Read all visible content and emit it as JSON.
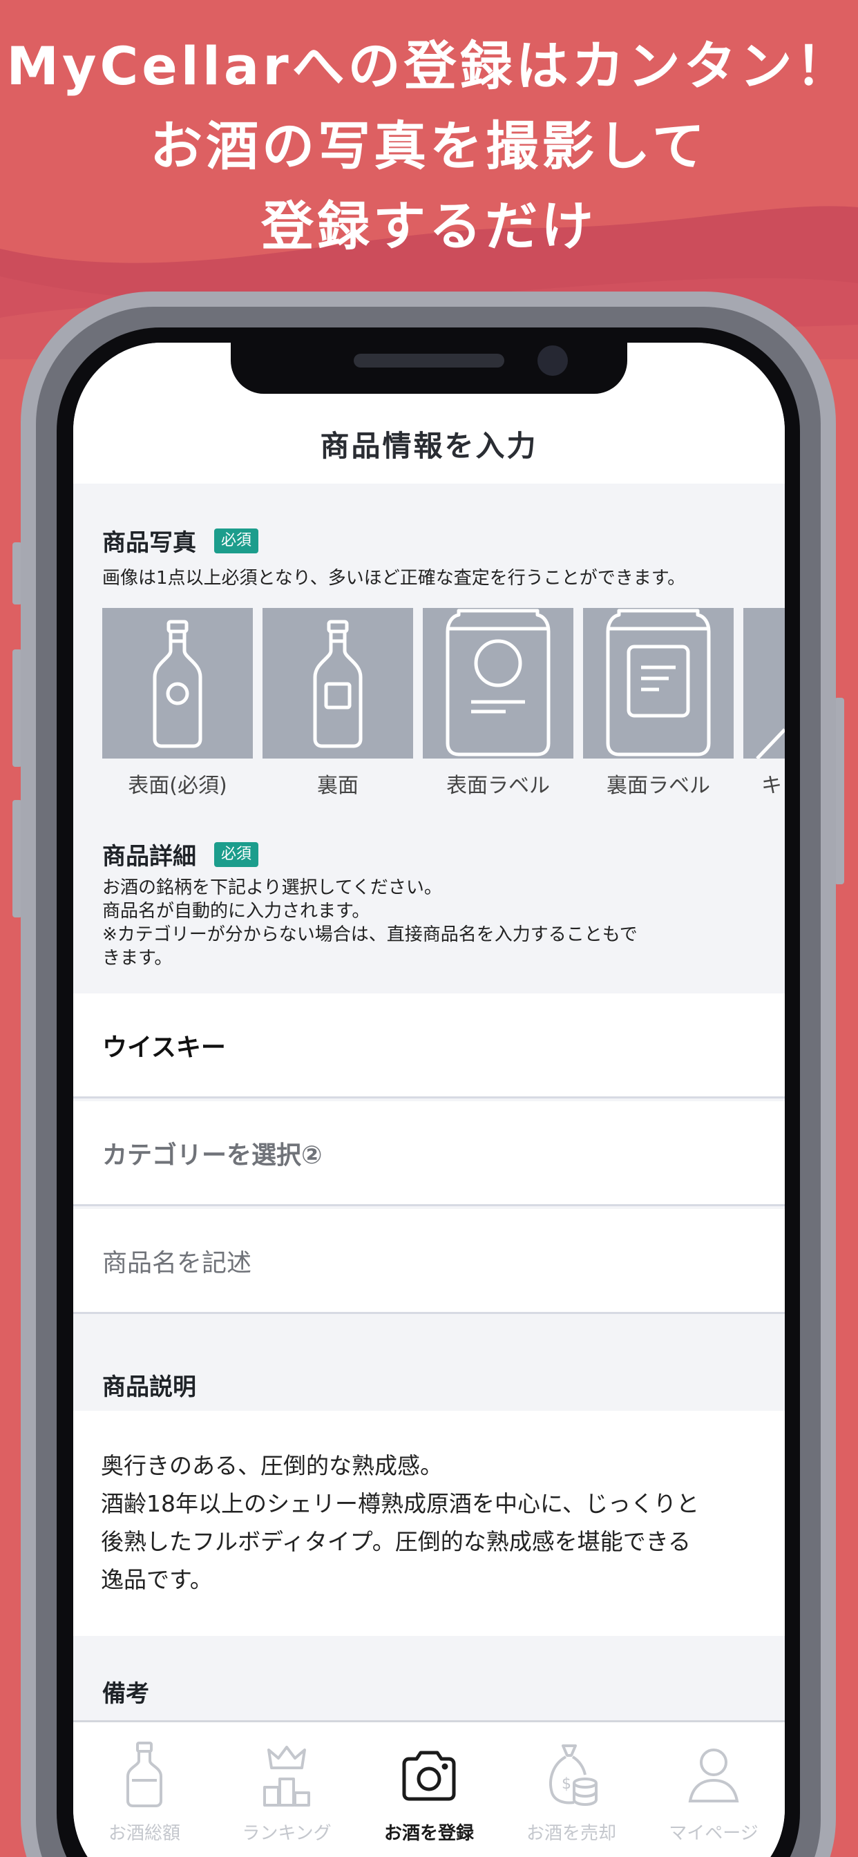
{
  "headline": {
    "line1": "MyCellarへの登録はカンタン！",
    "line2": "お酒の写真を撮影して",
    "line3": "登録するだけ"
  },
  "screen_title": "商品情報を入力",
  "photos": {
    "title": "商品写真",
    "badge": "必須",
    "note": "画像は1点以上必須となり、多いほど正確な査定を行うことができます。",
    "tiles": [
      {
        "label": "表面(必須)",
        "icon": "bottle-front-icon"
      },
      {
        "label": "裏面",
        "icon": "bottle-back-icon"
      },
      {
        "label": "表面ラベル",
        "icon": "label-front-icon"
      },
      {
        "label": "裏面ラベル",
        "icon": "label-back-icon"
      },
      {
        "label": "キ",
        "icon": "cap-icon"
      }
    ]
  },
  "details": {
    "title": "商品詳細",
    "badge": "必須",
    "note_lines": [
      "お酒の銘柄を下記より選択してください。",
      "商品名が自動的に入力されます。",
      "※カテゴリーが分からない場合は、直接商品名を入力することもで",
      "きます。"
    ],
    "category_selected": "ウイスキー",
    "subcategory_placeholder": "カテゴリーを選択②",
    "name_placeholder": "商品名を記述"
  },
  "description": {
    "title": "商品説明",
    "lines": [
      "奥行きのある、圧倒的な熟成感。",
      "酒齢18年以上のシェリー樽熟成原酒を中心に、じっくりと",
      "後熟したフルボディタイプ。圧倒的な熟成感を堪能できる",
      "逸品です。"
    ]
  },
  "remarks": {
    "title": "備考"
  },
  "tabbar": {
    "tabs": [
      {
        "label": "お酒総額",
        "icon": "bottle-icon",
        "active": false
      },
      {
        "label": "ランキング",
        "icon": "crown-podium-icon",
        "active": false
      },
      {
        "label": "お酒を登録",
        "icon": "camera-icon",
        "active": true
      },
      {
        "label": "お酒を売却",
        "icon": "money-bag-icon",
        "active": false
      },
      {
        "label": "マイページ",
        "icon": "person-icon",
        "active": false
      }
    ]
  },
  "colors": {
    "background": "#dd6062",
    "wave": "#c94a5a",
    "badge": "#1c9d8c",
    "photo_tile": "#a5abb6",
    "inactive_tab": "#c4c7cd"
  }
}
